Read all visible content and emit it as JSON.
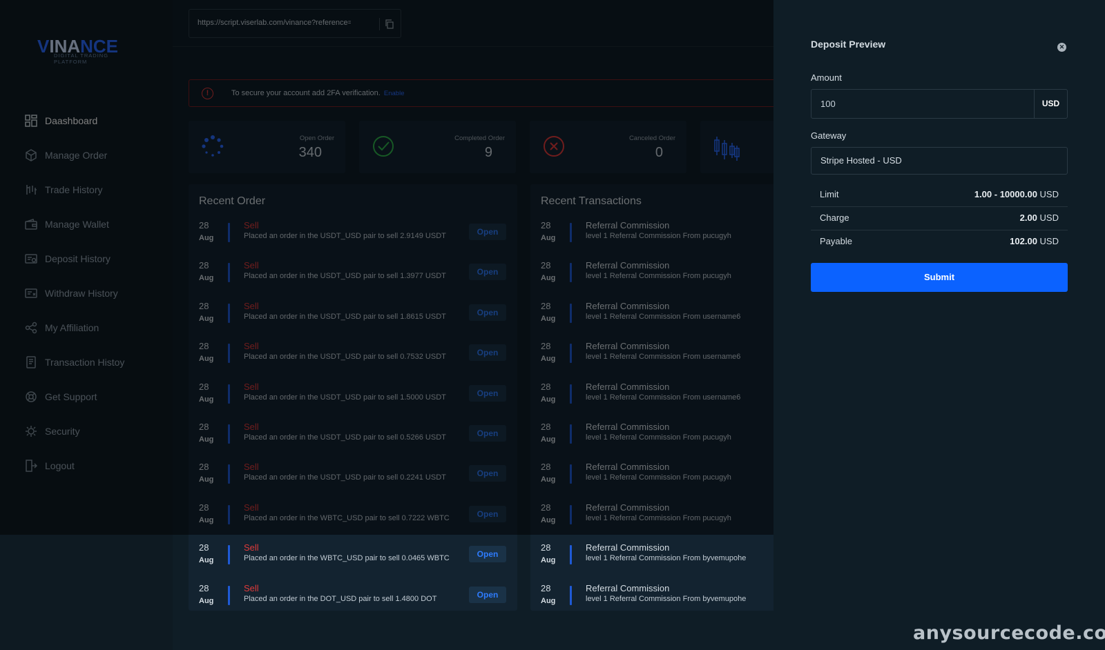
{
  "brand": {
    "name_part1": "V",
    "name_part2": "INA",
    "name_part3": "NCE",
    "tagline": "DIGITAL TRADING PLATFORM"
  },
  "referral": {
    "url": "https://script.viserlab.com/vinance?reference=",
    "copy_icon": "copy-icon"
  },
  "sidebar": {
    "items": [
      {
        "label": "Daashboard",
        "icon": "dashboard-icon",
        "active": true
      },
      {
        "label": "Manage Order",
        "icon": "order-icon"
      },
      {
        "label": "Trade History",
        "icon": "trade-history-icon"
      },
      {
        "label": "Manage Wallet",
        "icon": "wallet-icon"
      },
      {
        "label": "Deposit History",
        "icon": "deposit-history-icon"
      },
      {
        "label": "Withdraw History",
        "icon": "withdraw-history-icon"
      },
      {
        "label": "My Affiliation",
        "icon": "affiliation-icon"
      },
      {
        "label": "Transaction Histoy",
        "icon": "transaction-icon"
      },
      {
        "label": "Get Support",
        "icon": "support-icon"
      },
      {
        "label": "Security",
        "icon": "security-icon"
      },
      {
        "label": "Logout",
        "icon": "logout-icon"
      }
    ]
  },
  "alert": {
    "message": "To secure your account add 2FA verification.",
    "link": "Enable",
    "icon": "exclamation-icon"
  },
  "stats": [
    {
      "label": "Open Order",
      "value": "340",
      "icon": "spinner-icon",
      "color": "#2b6bff"
    },
    {
      "label": "Completed Order",
      "value": "9",
      "icon": "check-circle-icon",
      "color": "#2fb24a"
    },
    {
      "label": "Canceled Order",
      "value": "0",
      "icon": "x-circle-icon",
      "color": "#e03a3a"
    },
    {
      "label": "",
      "value": "",
      "icon": "candlestick-icon",
      "color": "#2b6bff"
    }
  ],
  "recent_order": {
    "title": "Recent Order",
    "rows": [
      {
        "day": "28",
        "month": "Aug",
        "type": "Sell",
        "text": "Placed an order in the USDT_USD pair to sell 2.9149 USDT",
        "status": "Open"
      },
      {
        "day": "28",
        "month": "Aug",
        "type": "Sell",
        "text": "Placed an order in the USDT_USD pair to sell 1.3977 USDT",
        "status": "Open"
      },
      {
        "day": "28",
        "month": "Aug",
        "type": "Sell",
        "text": "Placed an order in the USDT_USD pair to sell 1.8615 USDT",
        "status": "Open"
      },
      {
        "day": "28",
        "month": "Aug",
        "type": "Sell",
        "text": "Placed an order in the USDT_USD pair to sell 0.7532 USDT",
        "status": "Open"
      },
      {
        "day": "28",
        "month": "Aug",
        "type": "Sell",
        "text": "Placed an order in the USDT_USD pair to sell 1.5000 USDT",
        "status": "Open"
      },
      {
        "day": "28",
        "month": "Aug",
        "type": "Sell",
        "text": "Placed an order in the USDT_USD pair to sell 0.5266 USDT",
        "status": "Open"
      },
      {
        "day": "28",
        "month": "Aug",
        "type": "Sell",
        "text": "Placed an order in the USDT_USD pair to sell 0.2241 USDT",
        "status": "Open"
      },
      {
        "day": "28",
        "month": "Aug",
        "type": "Sell",
        "text": "Placed an order in the WBTC_USD pair to sell 0.7222 WBTC",
        "status": "Open"
      },
      {
        "day": "28",
        "month": "Aug",
        "type": "Sell",
        "text": "Placed an order in the WBTC_USD pair to sell 0.0465 WBTC",
        "status": "Open"
      },
      {
        "day": "28",
        "month": "Aug",
        "type": "Sell",
        "text": "Placed an order in the DOT_USD pair to sell 1.4800 DOT",
        "status": "Open"
      }
    ]
  },
  "recent_transactions": {
    "title": "Recent Transactions",
    "rows": [
      {
        "day": "28",
        "month": "Aug",
        "title": "Referral Commission",
        "text": "level 1 Referral Commission From pucugyh"
      },
      {
        "day": "28",
        "month": "Aug",
        "title": "Referral Commission",
        "text": "level 1 Referral Commission From pucugyh"
      },
      {
        "day": "28",
        "month": "Aug",
        "title": "Referral Commission",
        "text": "level 1 Referral Commission From username6"
      },
      {
        "day": "28",
        "month": "Aug",
        "title": "Referral Commission",
        "text": "level 1 Referral Commission From username6"
      },
      {
        "day": "28",
        "month": "Aug",
        "title": "Referral Commission",
        "text": "level 1 Referral Commission From username6"
      },
      {
        "day": "28",
        "month": "Aug",
        "title": "Referral Commission",
        "text": "level 1 Referral Commission From pucugyh"
      },
      {
        "day": "28",
        "month": "Aug",
        "title": "Referral Commission",
        "text": "level 1 Referral Commission From pucugyh"
      },
      {
        "day": "28",
        "month": "Aug",
        "title": "Referral Commission",
        "text": "level 1 Referral Commission From pucugyh"
      },
      {
        "day": "28",
        "month": "Aug",
        "title": "Referral Commission",
        "text": "level 1 Referral Commission From byvemupohe"
      },
      {
        "day": "28",
        "month": "Aug",
        "title": "Referral Commission",
        "text": "level 1 Referral Commission From byvemupohe"
      }
    ]
  },
  "deposit_preview": {
    "title": "Deposit Preview",
    "close_icon": "close-icon",
    "amount_label": "Amount",
    "amount_value": "100",
    "amount_unit": "USD",
    "gateway_label": "Gateway",
    "gateway_value": "Stripe Hosted - USD",
    "limit_label": "Limit",
    "limit_value": "1.00 - 10000.00",
    "limit_unit": "USD",
    "charge_label": "Charge",
    "charge_value": "2.00",
    "charge_unit": "USD",
    "payable_label": "Payable",
    "payable_value": "102.00",
    "payable_unit": "USD",
    "submit_label": "Submit"
  },
  "watermark": "anysourcecode.com",
  "colors": {
    "accent": "#0b62ff",
    "sell": "#e03a3a",
    "open_badge": "#2e7cff",
    "bg": "#0f1d26"
  }
}
